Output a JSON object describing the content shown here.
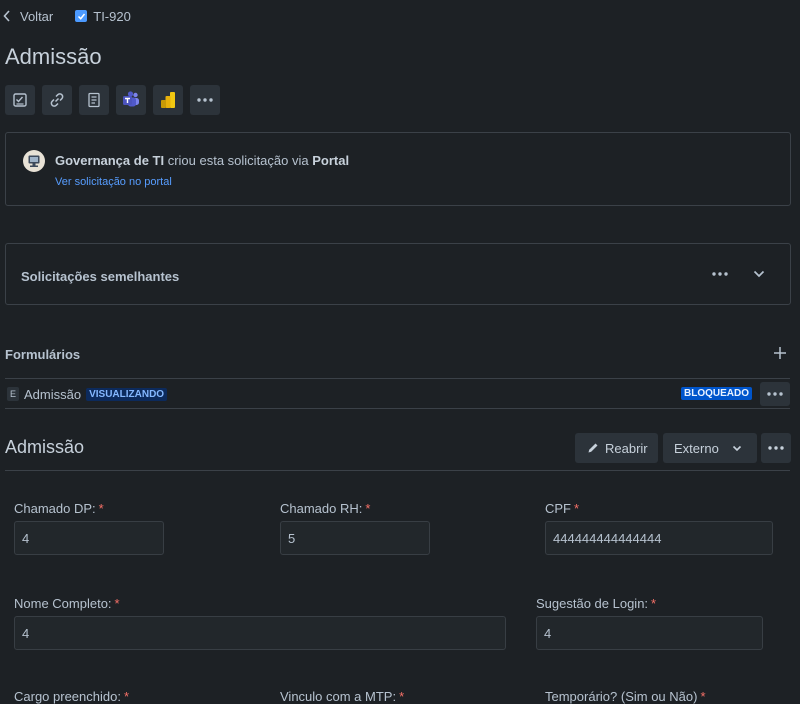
{
  "topbar": {
    "back_label": "Voltar",
    "issue_key": "TI-920"
  },
  "page_title": "Admissão",
  "portal": {
    "team": "Governança de TI",
    "middle": " criou esta solicitação via ",
    "channel": "Portal",
    "link": "Ver solicitação no portal"
  },
  "similar": {
    "title": "Solicitações semelhantes"
  },
  "forms": {
    "title": "Formulários",
    "row": {
      "icon_letter": "E",
      "name": "Admissão",
      "badge_view": "VISUALIZANDO",
      "badge_block": "BLOQUEADO"
    }
  },
  "section": {
    "title": "Admissão",
    "reabrir": "Reabrir",
    "externo": "Externo"
  },
  "fields": {
    "chamado_dp": {
      "label": "Chamado DP:",
      "value": "4"
    },
    "chamado_rh": {
      "label": "Chamado RH:",
      "value": "5"
    },
    "cpf": {
      "label": "CPF",
      "value": "444444444444444"
    },
    "nome": {
      "label": "Nome Completo:",
      "value": "4"
    },
    "login": {
      "label": "Sugestão de Login:",
      "value": "4"
    },
    "cargo": {
      "label": "Cargo preenchido:"
    },
    "vinculo": {
      "label": "Vinculo com a MTP:"
    },
    "temporario": {
      "label": "Temporário? (Sim ou Não)"
    }
  },
  "required_mark": "*",
  "colors": {
    "background": "#1d2125",
    "accent": "#579dff",
    "required": "#f87168",
    "badge_block": "#0055cc"
  }
}
